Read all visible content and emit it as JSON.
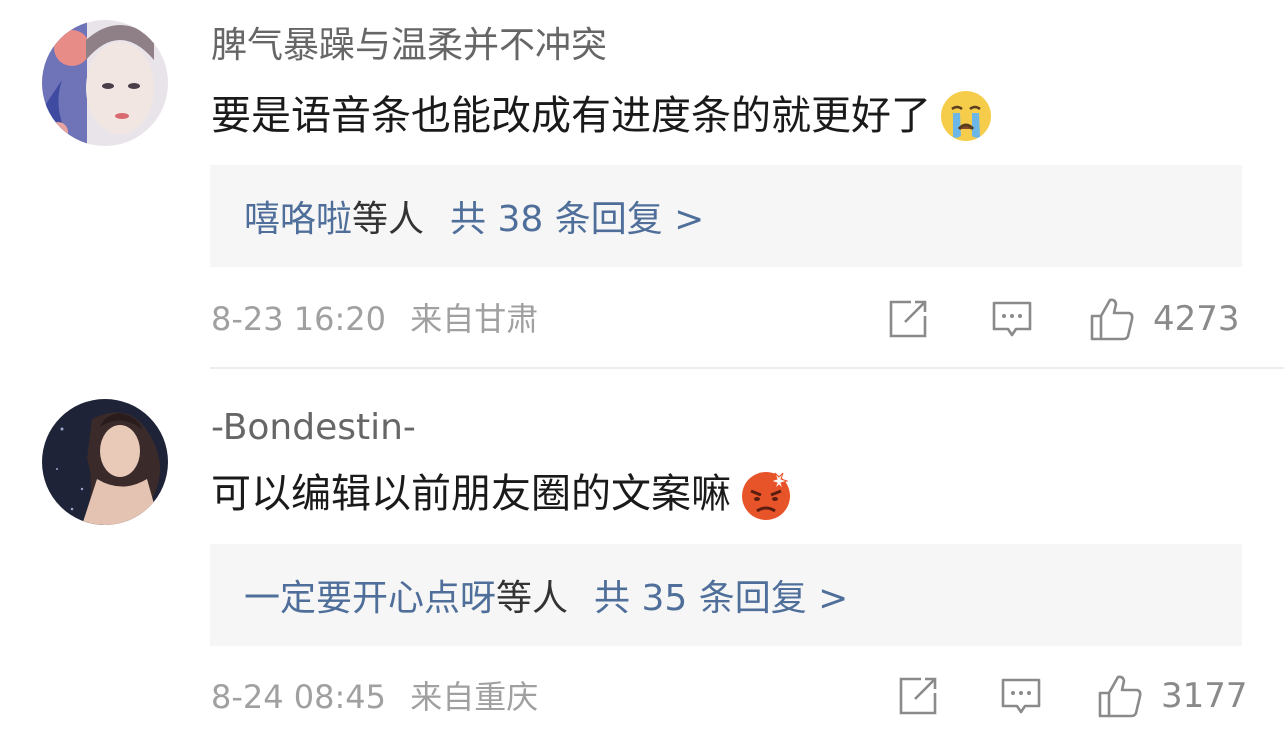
{
  "comments": [
    {
      "username": "脾气暴躁与温柔并不冲突",
      "content": "要是语音条也能改成有进度条的就更好了",
      "content_emoji": "crying-face-emoji",
      "replies": {
        "names": "嘻咯啦",
        "etc": "等人",
        "count": "共 38 条回复 >"
      },
      "date": "8-23 16:20",
      "location": "来自甘肃",
      "like_count": "4273"
    },
    {
      "username": "-Bondestin-",
      "content": "可以编辑以前朋友圈的文案嘛",
      "content_emoji": "angry-face-emoji",
      "replies": {
        "names": "一定要开心点呀",
        "etc": "等人",
        "count": "共 35 条回复 >"
      },
      "date": "8-24 08:45",
      "location": "来自重庆",
      "like_count": "3177"
    }
  ],
  "icons": {
    "share": "share-edit-icon",
    "comment": "comment-bubble-icon",
    "like": "thumbs-up-icon"
  },
  "colors": {
    "link_blue": "#4f6f9a",
    "reply_bg": "#f6f6f6",
    "meta_gray": "#a0a0a0"
  }
}
